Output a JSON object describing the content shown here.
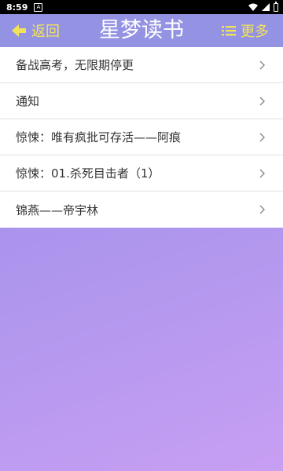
{
  "status_bar": {
    "time": "8:59",
    "notification_icon": "A"
  },
  "header": {
    "back_label": "返回",
    "title": "星梦读书",
    "more_label": "更多",
    "accent_color": "#f2e25a",
    "background_color": "#9493e3"
  },
  "list": {
    "items": [
      {
        "label": "备战高考，无限期停更"
      },
      {
        "label": "通知"
      },
      {
        "label": "惊悚：唯有疯批可存活——阿痕"
      },
      {
        "label": "惊悚：01.杀死目击者（1）"
      },
      {
        "label": "锦燕——帝宇林"
      }
    ]
  }
}
